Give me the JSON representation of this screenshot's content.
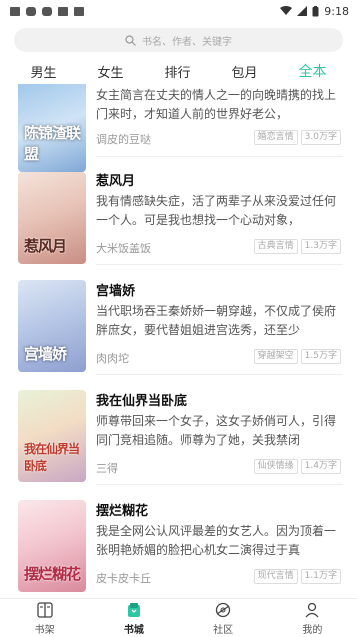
{
  "status_bar": {
    "time": "9:18"
  },
  "search": {
    "placeholder": "书名、作者、关键字"
  },
  "tabs": [
    {
      "label": "男生",
      "active": false
    },
    {
      "label": "女生",
      "active": false
    },
    {
      "label": "排行",
      "active": false
    },
    {
      "label": "包月",
      "active": false
    },
    {
      "label": "全本",
      "active": true
    }
  ],
  "books": [
    {
      "title": "",
      "cover_text": "陈锦渣联盟",
      "desc": "女主简言在丈夫的情人之一的向晚晴携的找上门来时，才知道人前的世界好老公，",
      "author": "调皮的豆哒",
      "tag1": "婚恋言情",
      "tag2": "3.0万字"
    },
    {
      "title": "惹风月",
      "cover_text": "惹风月",
      "desc": "我有情感缺失症，活了两辈子从来没爱过任何一个人。可是我也想找一个心动对象，",
      "author": "大米饭盖饭",
      "tag1": "古典言情",
      "tag2": "1.3万字"
    },
    {
      "title": "宫墙娇",
      "cover_text": "宫墙娇",
      "desc": "当代职场吞王秦娇娇一朝穿越，不仅成了侯府胖庶女，要代替姐姐进宫选秀，还至少",
      "author": "肉肉坨",
      "tag1": "穿越架空",
      "tag2": "1.5万字"
    },
    {
      "title": "我在仙界当卧底",
      "cover_text": "我在仙界当卧底",
      "desc": "师尊带回来一个女子，这女子娇俏可人，引得同门竞相追随。师尊为了她，关我禁闭",
      "author": "三得",
      "tag1": "仙侠情缘",
      "tag2": "1.4万字"
    },
    {
      "title": "摆烂糊花",
      "cover_text": "摆烂糊花",
      "desc": "我是全网公认风评最差的女艺人。因为顶着一张明艳娇媚的脸把心机女二演得过于真",
      "author": "皮卡皮卡丘",
      "tag1": "现代言情",
      "tag2": "1.1万字"
    }
  ],
  "nav": [
    {
      "label": "书架",
      "icon": "bookshelf-icon"
    },
    {
      "label": "书城",
      "icon": "bookstore-icon",
      "active": true
    },
    {
      "label": "社区",
      "icon": "community-icon"
    },
    {
      "label": "我的",
      "icon": "profile-icon"
    }
  ],
  "colors": {
    "accent": "#2fc6a4"
  }
}
